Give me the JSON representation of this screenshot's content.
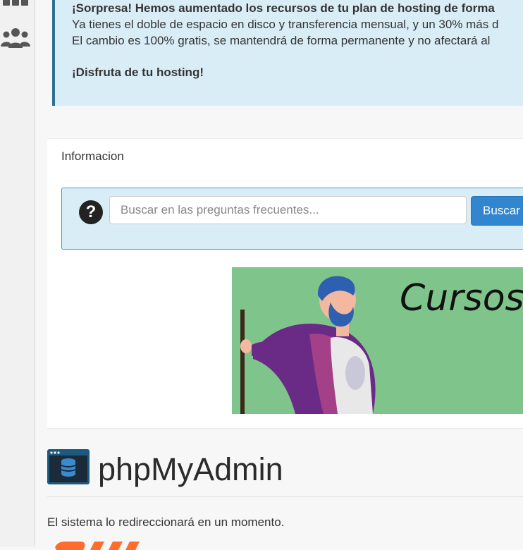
{
  "sidebar": {
    "icons": [
      "grid-icon",
      "users-icon"
    ]
  },
  "alert": {
    "headline": "¡Sorpresa! Hemos aumentado los recursos de tu plan de hosting de forma",
    "line1": "Ya tienes el doble de espacio en disco y transferencia mensual, y un 30% más d",
    "line2": "El cambio es 100% gratis, se mantendrá de forma permanente y no afectará al",
    "closing": "¡Disfruta de tu hosting!"
  },
  "info_panel": {
    "title": "Informacion",
    "search": {
      "placeholder": "Buscar en las preguntas frecuentes...",
      "value": "",
      "button_label": "Buscar"
    },
    "banner": {
      "text": "Cursos"
    }
  },
  "phpmyadmin": {
    "title": "phpMyAdmin",
    "redirect_message": "El sistema lo redireccionará en un momento."
  },
  "colors": {
    "alert_bg": "#d9edf7",
    "alert_border": "#31708f",
    "button_blue": "#3286d0",
    "banner_green": "#7fc58b"
  }
}
